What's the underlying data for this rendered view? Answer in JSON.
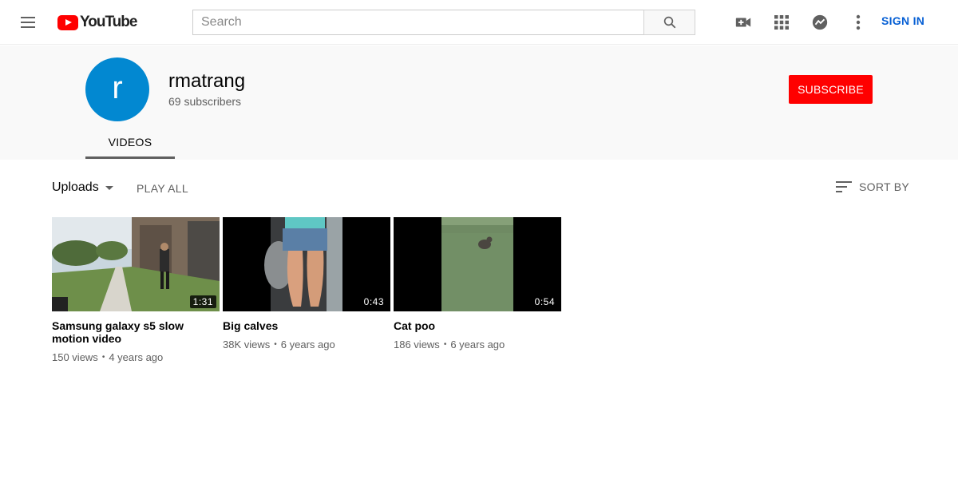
{
  "masthead": {
    "logo_text": "YouTube",
    "search_placeholder": "Search",
    "signin_label": "SIGN IN",
    "icons": [
      "menu-icon",
      "search-icon",
      "create-video-icon",
      "apps-icon",
      "messages-icon",
      "more-icon"
    ]
  },
  "channel": {
    "avatar_letter": "r",
    "avatar_color": "#0288d1",
    "name": "rmatrang",
    "subscribers": "69 subscribers",
    "subscribe_label": "SUBSCRIBE",
    "tab": "VIDEOS"
  },
  "content": {
    "uploads_label": "Uploads",
    "play_all_label": "PLAY ALL",
    "sort_label": "SORT BY",
    "videos": [
      {
        "title": "Samsung galaxy s5 slow motion video",
        "duration": "1:31",
        "views": "150 views",
        "age": "4 years ago"
      },
      {
        "title": "Big calves",
        "duration": "0:43",
        "views": "38K views",
        "age": "6 years ago"
      },
      {
        "title": "Cat poo",
        "duration": "0:54",
        "views": "186 views",
        "age": "6 years ago"
      }
    ]
  },
  "colors": {
    "brand": "#ff0000",
    "link": "#065fd4",
    "header_bg": "#f9f9f9"
  }
}
